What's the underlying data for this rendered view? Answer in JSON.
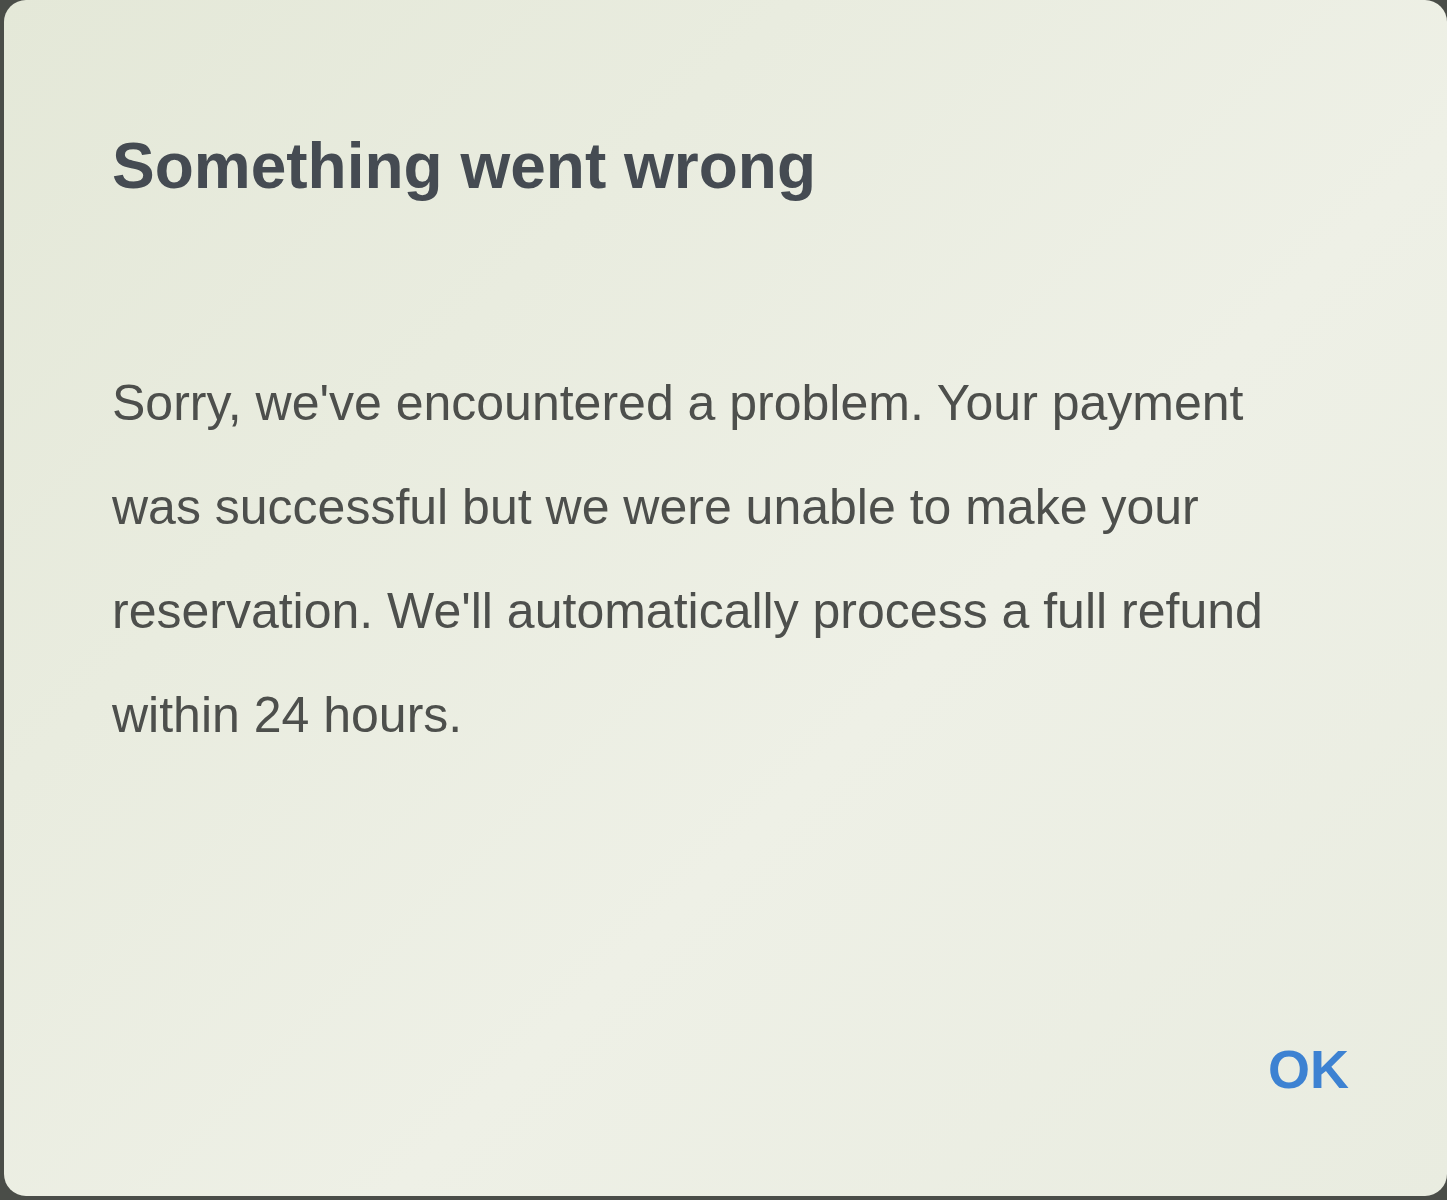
{
  "dialog": {
    "title": "Something went wrong",
    "message": "Sorry, we've encountered a problem. Your payment was successful but we were unable to make your reservation. We'll automatically process a full refund within 24 hours.",
    "buttons": [
      "OK"
    ]
  }
}
